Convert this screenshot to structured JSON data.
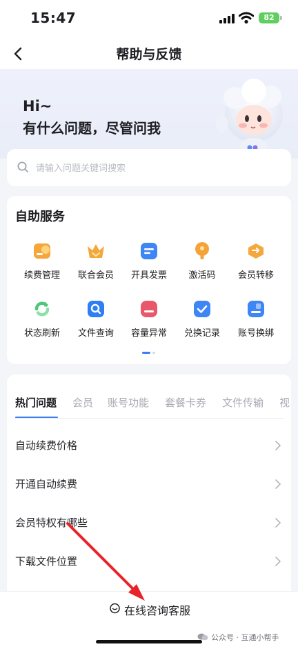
{
  "status_bar": {
    "time": "15:47",
    "battery": "82"
  },
  "nav": {
    "title": "帮助与反馈"
  },
  "hero": {
    "greeting": "Hi~",
    "subtitle": "有什么问题，尽管问我"
  },
  "search": {
    "placeholder": "请输入问题关键词搜索"
  },
  "self_service": {
    "title": "自助服务",
    "items": [
      {
        "label": "续费管理",
        "icon": "renewal-icon",
        "color": "#f6a53a"
      },
      {
        "label": "联合会员",
        "icon": "crown-icon",
        "color": "#f4a83c"
      },
      {
        "label": "开具发票",
        "icon": "invoice-icon",
        "color": "#3e86f5"
      },
      {
        "label": "激活码",
        "icon": "key-icon",
        "color": "#f3a338"
      },
      {
        "label": "会员转移",
        "icon": "transfer-icon",
        "color": "#f4a83c"
      },
      {
        "label": "状态刷新",
        "icon": "refresh-icon",
        "color": "#4fc77a"
      },
      {
        "label": "文件查询",
        "icon": "file-search-icon",
        "color": "#2f7ef3"
      },
      {
        "label": "容量异常",
        "icon": "storage-alert-icon",
        "color": "#e9576a"
      },
      {
        "label": "兑换记录",
        "icon": "check-icon",
        "color": "#3e86f5"
      },
      {
        "label": "账号换绑",
        "icon": "account-icon",
        "color": "#3e86f5"
      }
    ]
  },
  "faq": {
    "tabs": [
      "热门问题",
      "会员",
      "账号功能",
      "套餐卡券",
      "文件传输",
      "视"
    ],
    "items": [
      {
        "label": "自动续费价格"
      },
      {
        "label": "开通自动续费"
      },
      {
        "label": "会员特权有哪些"
      },
      {
        "label": "下载文件位置"
      }
    ]
  },
  "footer": {
    "cs_label": "在线咨询客服",
    "watermark": "公众号 · 互通小帮手"
  },
  "colors": {
    "accent": "#3b7cf6",
    "annotation_arrow": "#e8242a"
  }
}
